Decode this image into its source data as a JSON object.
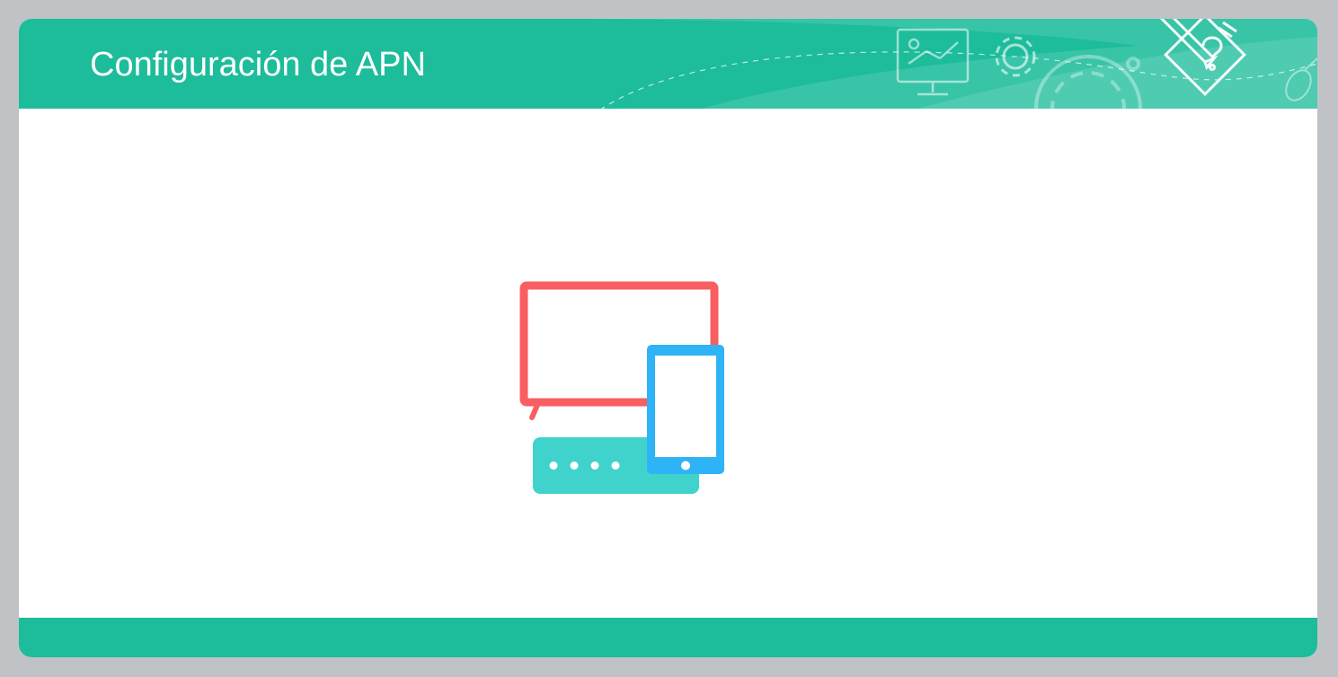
{
  "header": {
    "title": "Configuración de APN",
    "decor_icons": [
      "presentation-board-icon",
      "gear-icon",
      "large-gear-icon",
      "pencil-diamond-icon",
      "mouse-icon"
    ]
  },
  "illustration": {
    "icons": [
      "tv-monitor-icon",
      "tablet-icon",
      "router-icon"
    ],
    "router_dots": 4
  },
  "colors": {
    "page_background": "#bfc3c6",
    "header": "#1dbc9b",
    "footer": "#1dbc9b",
    "title_text": "#ffffff",
    "monitor": "#f85e62",
    "tablet": "#2fb3f7",
    "router": "#40d3cc"
  }
}
